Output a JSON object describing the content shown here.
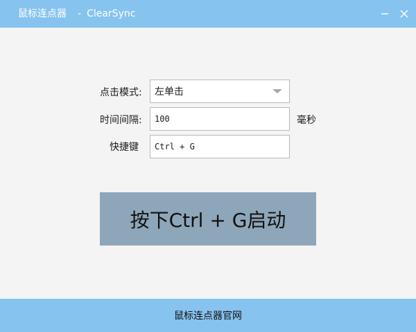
{
  "window": {
    "title": "鼠标连点器",
    "title_separator": "-",
    "subtitle": "ClearSync",
    "minimize_icon": "minimize-icon",
    "close_icon": "close-icon"
  },
  "form": {
    "mode_label": "点击模式:",
    "mode_value": "左单击",
    "interval_label": "时间间隔:",
    "interval_value": "100",
    "interval_unit": "毫秒",
    "hotkey_label": "快捷键",
    "hotkey_value": "Ctrl + G"
  },
  "start_button": {
    "label": "按下Ctrl + G启动"
  },
  "footer": {
    "link_text": "鼠标连点器官网"
  },
  "colors": {
    "titlebar": "#86c3ee",
    "footer": "#86c3ee",
    "start_button": "#8ea6b9",
    "background": "#f4f4f4"
  }
}
